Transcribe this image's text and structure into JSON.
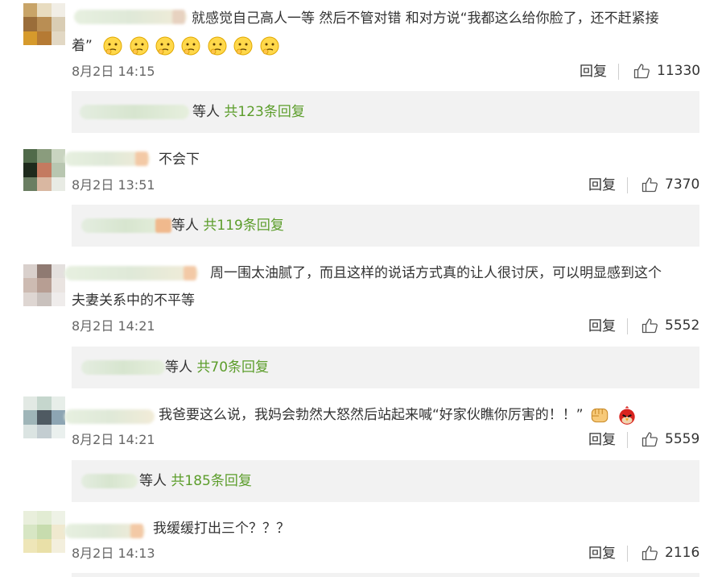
{
  "comments": [
    {
      "text_line1": "就感觉自己高人一等 然后不管对错 和对方说“我都这么给你脸了，还不赶紧接",
      "text_line2": "着”",
      "date": "8月2日 14:15",
      "reply_label": "回复",
      "likes": "11330",
      "replies_prefix": "等人",
      "replies_count": "共123条回复",
      "emoji_count": 7
    },
    {
      "text": "不会下",
      "date": "8月2日 13:51",
      "reply_label": "回复",
      "likes": "7370",
      "replies_prefix": "等人",
      "replies_count": "共119条回复"
    },
    {
      "text_line1": "周一围太油腻了，而且这样的说话方式真的让人很讨厌，可以明显感到这个",
      "text_line2": "夫妻关系中的不平等",
      "date": "8月2日 14:21",
      "reply_label": "回复",
      "likes": "5552",
      "replies_prefix": "等人",
      "replies_count": "共70条回复"
    },
    {
      "text": "我爸要这么说，我妈会勃然大怒然后站起来喊“好家伙瞧你厉害的！！”",
      "date": "8月2日 14:21",
      "reply_label": "回复",
      "likes": "5559",
      "replies_prefix": "等人",
      "replies_count": "共185条回复"
    },
    {
      "text": "我缓缓打出三个？？？",
      "date": "8月2日 14:13",
      "reply_label": "回复",
      "likes": "2116"
    }
  ],
  "colors": {
    "reply_count_green": "#5c9d2b",
    "reply_box_bg": "#f2f2f2",
    "text": "#333333",
    "meta": "#666666"
  },
  "icons": [
    "thumbs-up-icon",
    "thinking-emoji-icon",
    "fist-emoji-icon",
    "angry-bird-emoji-icon"
  ]
}
